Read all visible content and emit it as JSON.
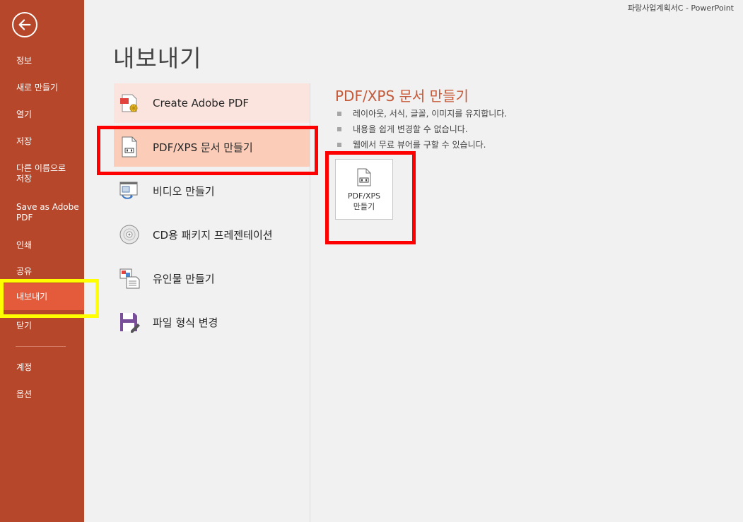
{
  "window": {
    "title": "파랑사업계획서C - PowerPoint"
  },
  "sidebar": {
    "items": [
      {
        "label": "정보"
      },
      {
        "label": "새로 만들기"
      },
      {
        "label": "열기"
      },
      {
        "label": "저장"
      },
      {
        "label": "다른 이름으로\n저장"
      },
      {
        "label": "Save as Adobe\nPDF"
      },
      {
        "label": "인쇄"
      },
      {
        "label": "공유"
      },
      {
        "label": "내보내기"
      },
      {
        "label": "닫기"
      },
      {
        "label": "계정"
      },
      {
        "label": "옵션"
      }
    ],
    "accent": "#b7472a",
    "active_color": "#e35b3a"
  },
  "page": {
    "title": "내보내기"
  },
  "options": [
    {
      "label": "Create Adobe PDF",
      "icon": "adobe-pdf-icon"
    },
    {
      "label": "PDF/XPS 문서 만들기",
      "icon": "pdf-xps-document-icon"
    },
    {
      "label": "비디오 만들기",
      "icon": "video-icon"
    },
    {
      "label": "CD용 패키지 프레젠테이션",
      "icon": "cd-icon"
    },
    {
      "label": "유인물 만들기",
      "icon": "handout-icon"
    },
    {
      "label": "파일 형식 변경",
      "icon": "save-as-icon"
    }
  ],
  "detail": {
    "title": "PDF/XPS 문서 만들기",
    "bullets": [
      "레이아웃, 서식, 글꼴, 이미지를 유지합니다.",
      "내용을 쉽게 변경할 수 없습니다.",
      "웹에서 무료 뷰어를 구할 수 있습니다."
    ],
    "button_label": "PDF/XPS\n만들기"
  },
  "annotations": {
    "red": "#ff0000",
    "yellow": "#ffff00"
  }
}
